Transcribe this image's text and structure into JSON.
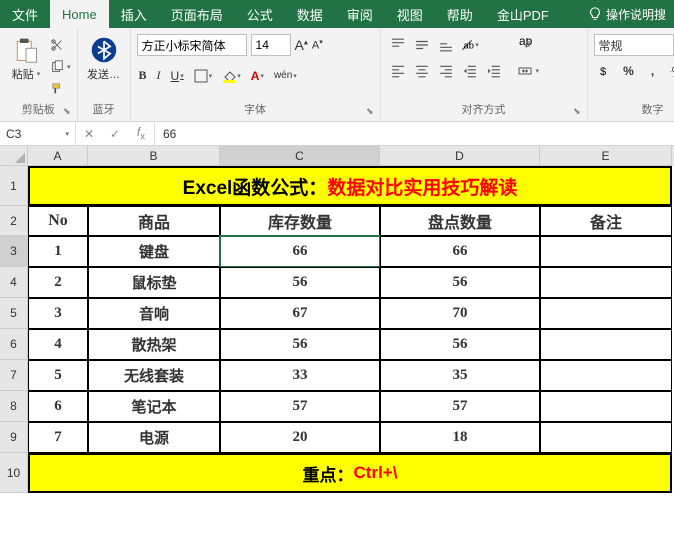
{
  "tabs": {
    "file": "文件",
    "home": "Home",
    "insert": "插入",
    "layout": "页面布局",
    "formula": "公式",
    "data": "数据",
    "review": "审阅",
    "view": "视图",
    "help": "帮助",
    "pdf": "金山PDF",
    "tell": "操作说明搜"
  },
  "groups": {
    "clipboard": "剪贴板",
    "bluetooth": "蓝牙",
    "font": "字体",
    "align": "对齐方式",
    "number": "数字"
  },
  "clipboard": {
    "paste": "粘贴"
  },
  "bt": {
    "send": "发送…"
  },
  "font": {
    "name": "方正小标宋简体",
    "size": "14",
    "bold": "B",
    "italic": "I",
    "underline": "U",
    "ruby": "wén"
  },
  "number": {
    "format": "常规"
  },
  "fbar": {
    "ref": "C3",
    "val": "66"
  },
  "cols": [
    "A",
    "B",
    "C",
    "D",
    "E"
  ],
  "title": {
    "p1": "Excel函数公式：",
    "p2": "数据对比实用技巧解读"
  },
  "hd": {
    "no": "No",
    "prod": "商品",
    "stock": "库存数量",
    "count": "盘点数量",
    "note": "备注"
  },
  "rows": [
    {
      "no": "1",
      "prod": "键盘",
      "stock": "66",
      "count": "66"
    },
    {
      "no": "2",
      "prod": "鼠标垫",
      "stock": "56",
      "count": "56"
    },
    {
      "no": "3",
      "prod": "音响",
      "stock": "67",
      "count": "70"
    },
    {
      "no": "4",
      "prod": "散热架",
      "stock": "56",
      "count": "56"
    },
    {
      "no": "5",
      "prod": "无线套装",
      "stock": "33",
      "count": "35"
    },
    {
      "no": "6",
      "prod": "笔记本",
      "stock": "57",
      "count": "57"
    },
    {
      "no": "7",
      "prod": "电源",
      "stock": "20",
      "count": "18"
    }
  ],
  "footer": {
    "p1": "重点：",
    "p2": "Ctrl+\\"
  },
  "active": "C3"
}
